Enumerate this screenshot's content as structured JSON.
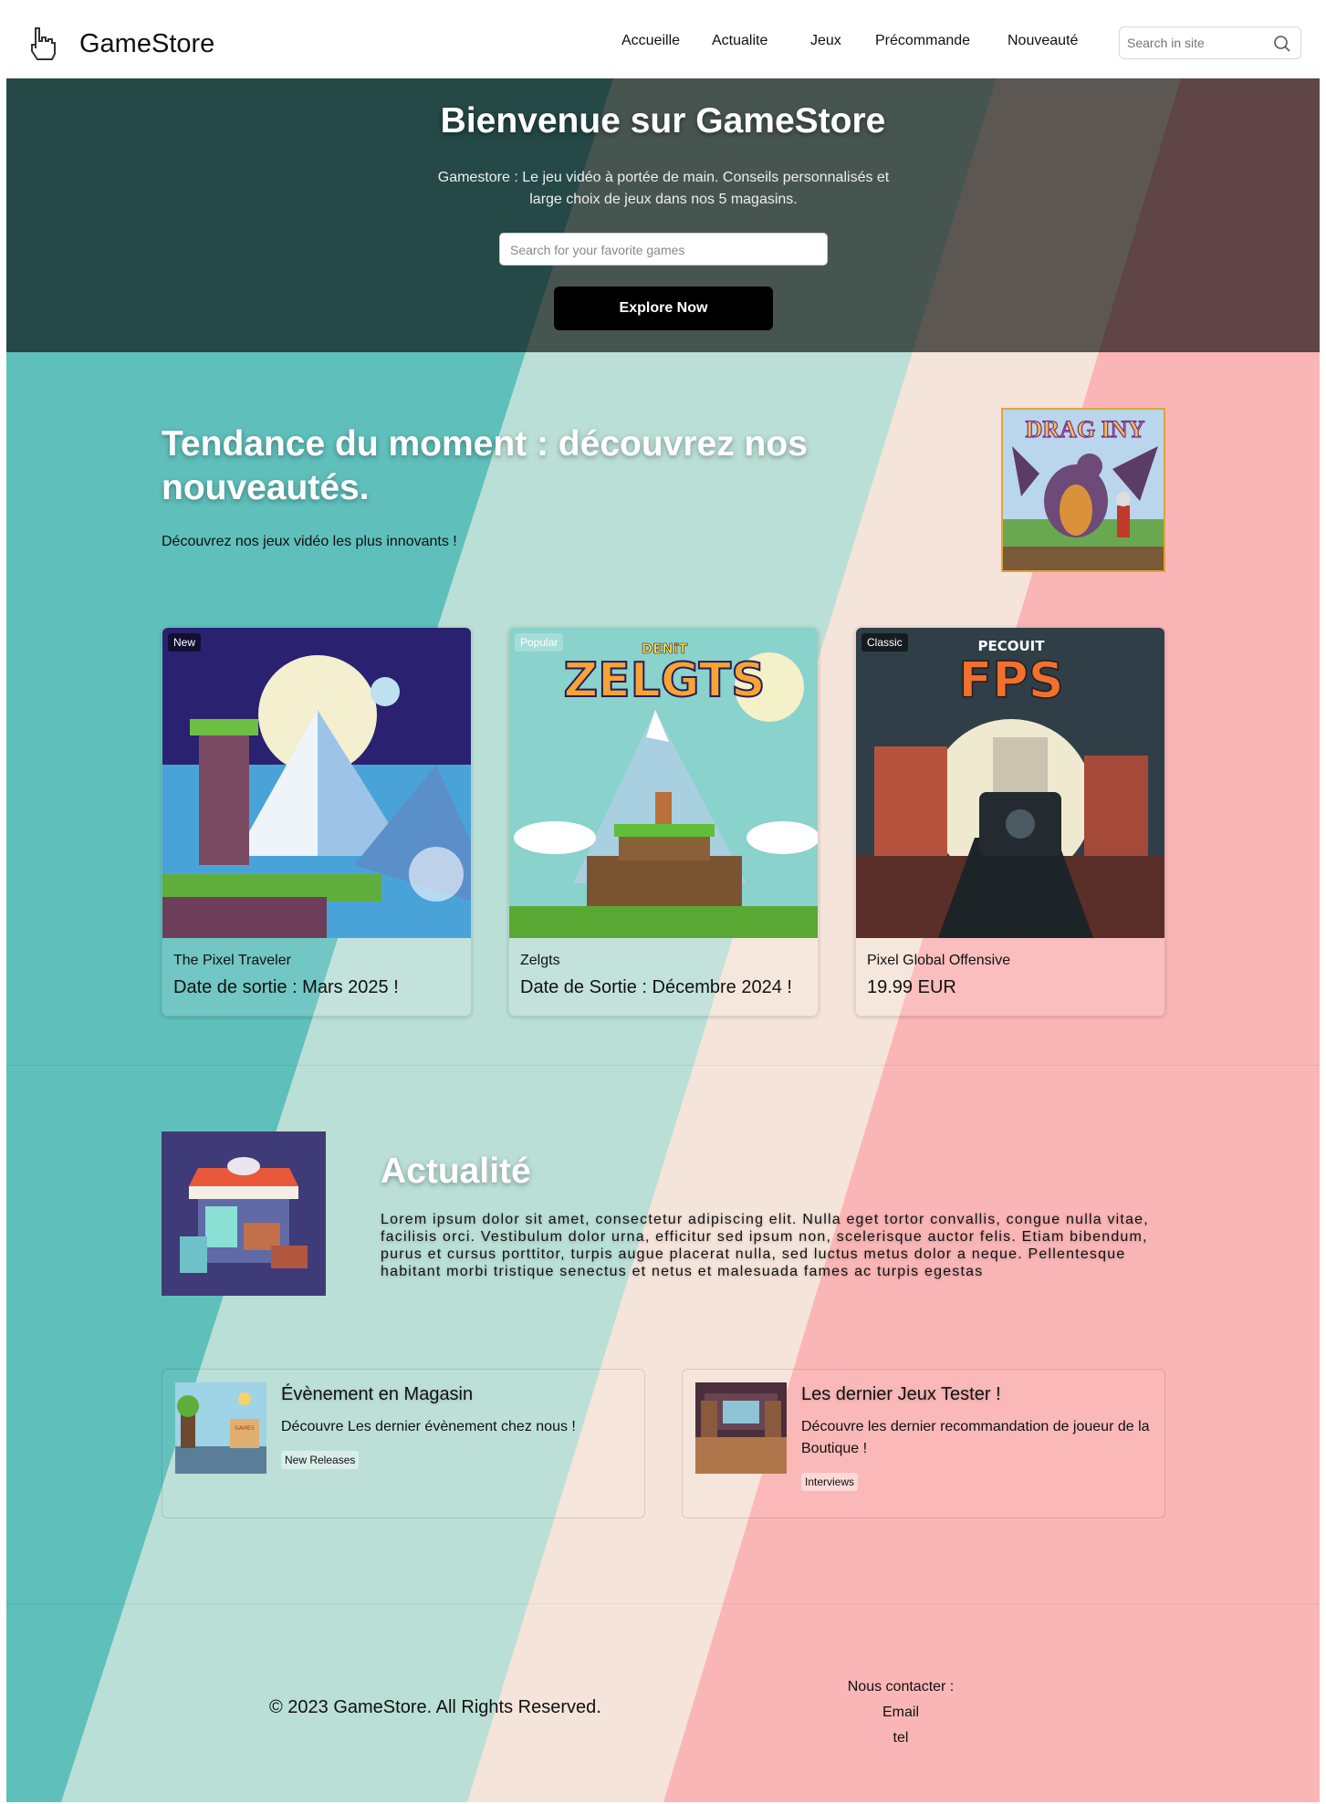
{
  "brand": {
    "name": "GameStore",
    "logo_icon": "pointer-hand-icon"
  },
  "nav": {
    "items": [
      "Accueille",
      "Actualite",
      "Jeux",
      "Précommande",
      "Nouveauté"
    ]
  },
  "search": {
    "placeholder": "Search in site",
    "icon": "search-icon"
  },
  "hero": {
    "title": "Bienvenue sur GameStore",
    "subtitle": "Gamestore : Le jeu vidéo à portée de main. Conseils personnalisés et large choix de jeux dans nos 5 magasins.",
    "search_placeholder": "Search for your favorite games",
    "cta_label": "Explore Now"
  },
  "trending": {
    "title": "Tendance du moment : découvrez nos nouveautés.",
    "subtitle": "Découvrez nos jeux vidéo les plus innovants !",
    "featured_logo": "DRAG INY",
    "cards": [
      {
        "badge": "New",
        "name": "The Pixel Traveler",
        "info": "Date de sortie : Mars 2025 !"
      },
      {
        "badge": "Popular",
        "name": "Zelgts",
        "info": "Date de Sortie : Décembre 2024 !",
        "art_text_top": "DENiT",
        "art_text_main": "ZELGTS"
      },
      {
        "badge": "Classic",
        "name": "Pixel Global Offensive",
        "info": "19.99  EUR",
        "art_text_top": "PECOUIT",
        "art_text_main": "FPS"
      }
    ]
  },
  "actualite": {
    "title": "Actualité",
    "text": "Lorem ipsum dolor sit amet, consectetur adipiscing elit. Nulla eget tortor convallis, congue nulla vitae, facilisis orci. Vestibulum dolor urna, efficitur sed ipsum non, scelerisque auctor felis. Etiam bibendum, purus et cursus porttitor, turpis augue placerat nulla, sed luctus metus dolor a neque. Pellentesque habitant morbi tristique senectus et netus et malesuada fames ac turpis egestas",
    "news": [
      {
        "title": "Évènement en Magasin",
        "desc": "Découvre Les dernier évènement chez nous !",
        "tag": "New Releases",
        "thumb_text": "GAMES"
      },
      {
        "title": "Les dernier Jeux Tester !",
        "desc": "Découvre les dernier recommandation de joueur de la Boutique !",
        "tag": "Interviews"
      }
    ]
  },
  "footer": {
    "copyright": "© 2023 GameStore. All Rights Reserved.",
    "contact_label": "Nous contacter :",
    "contact_email": "Email",
    "contact_tel": "tel"
  },
  "colors": {
    "teal": "#5fbfbb",
    "mint": "#badfd6",
    "cream": "#f5e4d9",
    "pink": "#fab6b6",
    "button": "#000000"
  }
}
